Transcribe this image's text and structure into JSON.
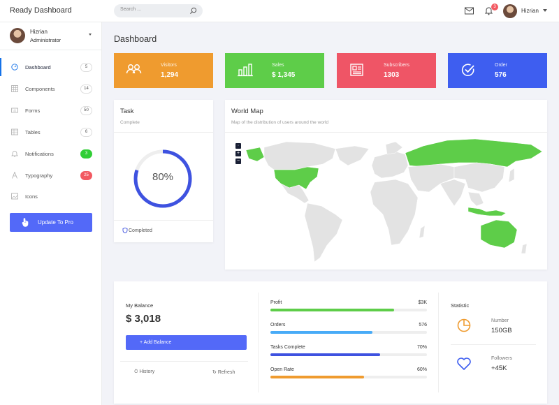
{
  "app": {
    "title": "Ready Dashboard"
  },
  "topbar": {
    "search_placeholder": "Search ...",
    "notification_count": "3",
    "user_name": "Hizrian"
  },
  "sidebar": {
    "user": {
      "name": "Hizrian",
      "role": "Administrator"
    },
    "items": [
      {
        "label": "Dashboard",
        "badge": "5",
        "icon": "gauge-icon"
      },
      {
        "label": "Components",
        "badge": "14",
        "icon": "grid-icon"
      },
      {
        "label": "Forms",
        "badge": "50",
        "icon": "keyboard-icon"
      },
      {
        "label": "Tables",
        "badge": "6",
        "icon": "table-icon"
      },
      {
        "label": "Notifications",
        "badge": "3",
        "icon": "bell-icon"
      },
      {
        "label": "Typography",
        "badge": "25",
        "icon": "font-icon"
      },
      {
        "label": "Icons",
        "badge": "",
        "icon": "photo-icon"
      }
    ],
    "upgrade_label": "Update To Pro"
  },
  "page": {
    "title": "Dashboard"
  },
  "stats": [
    {
      "label": "Visitors",
      "value": "1,294",
      "color": "#ef9b2f",
      "icon": "users-icon"
    },
    {
      "label": "Sales",
      "value": "$ 1,345",
      "color": "#5ecd49",
      "icon": "bar-chart-icon"
    },
    {
      "label": "Subscribers",
      "value": "1303",
      "color": "#ef5566",
      "icon": "newspaper-icon"
    },
    {
      "label": "Order",
      "value": "576",
      "color": "#3e5ef0",
      "icon": "check-circle-icon"
    }
  ],
  "task": {
    "title": "Task",
    "subtitle": "Complete",
    "percent_label": "80%",
    "percent": 80,
    "footer": "Completed"
  },
  "map": {
    "title": "World Map",
    "subtitle": "Map of the distribution of users around the world",
    "zoom_in": "+",
    "zoom_out": "−",
    "highlight_color": "#5ecd49"
  },
  "balance": {
    "label": "My Balance",
    "value": "$ 3,018",
    "add_label": "+ Add Balance",
    "history": "History",
    "refresh": "Refresh"
  },
  "progress": [
    {
      "label": "Profit",
      "value": "$3K",
      "fraction": 0.79,
      "color": "#5ecd49"
    },
    {
      "label": "Orders",
      "value": "576",
      "fraction": 0.65,
      "color": "#48abf7"
    },
    {
      "label": "Tasks Complete",
      "value": "70%",
      "fraction": 0.7,
      "color": "#3e52e0"
    },
    {
      "label": "Open Rate",
      "value": "60%",
      "fraction": 0.6,
      "color": "#ef9b2f"
    }
  ],
  "statistic": {
    "title": "Statistic",
    "items": [
      {
        "label": "Number",
        "value": "150GB",
        "icon": "pie-chart-icon",
        "color": "#ef9b2f"
      },
      {
        "label": "Followers",
        "value": "+45K",
        "icon": "heart-icon",
        "color": "#3e5ef0"
      }
    ]
  }
}
